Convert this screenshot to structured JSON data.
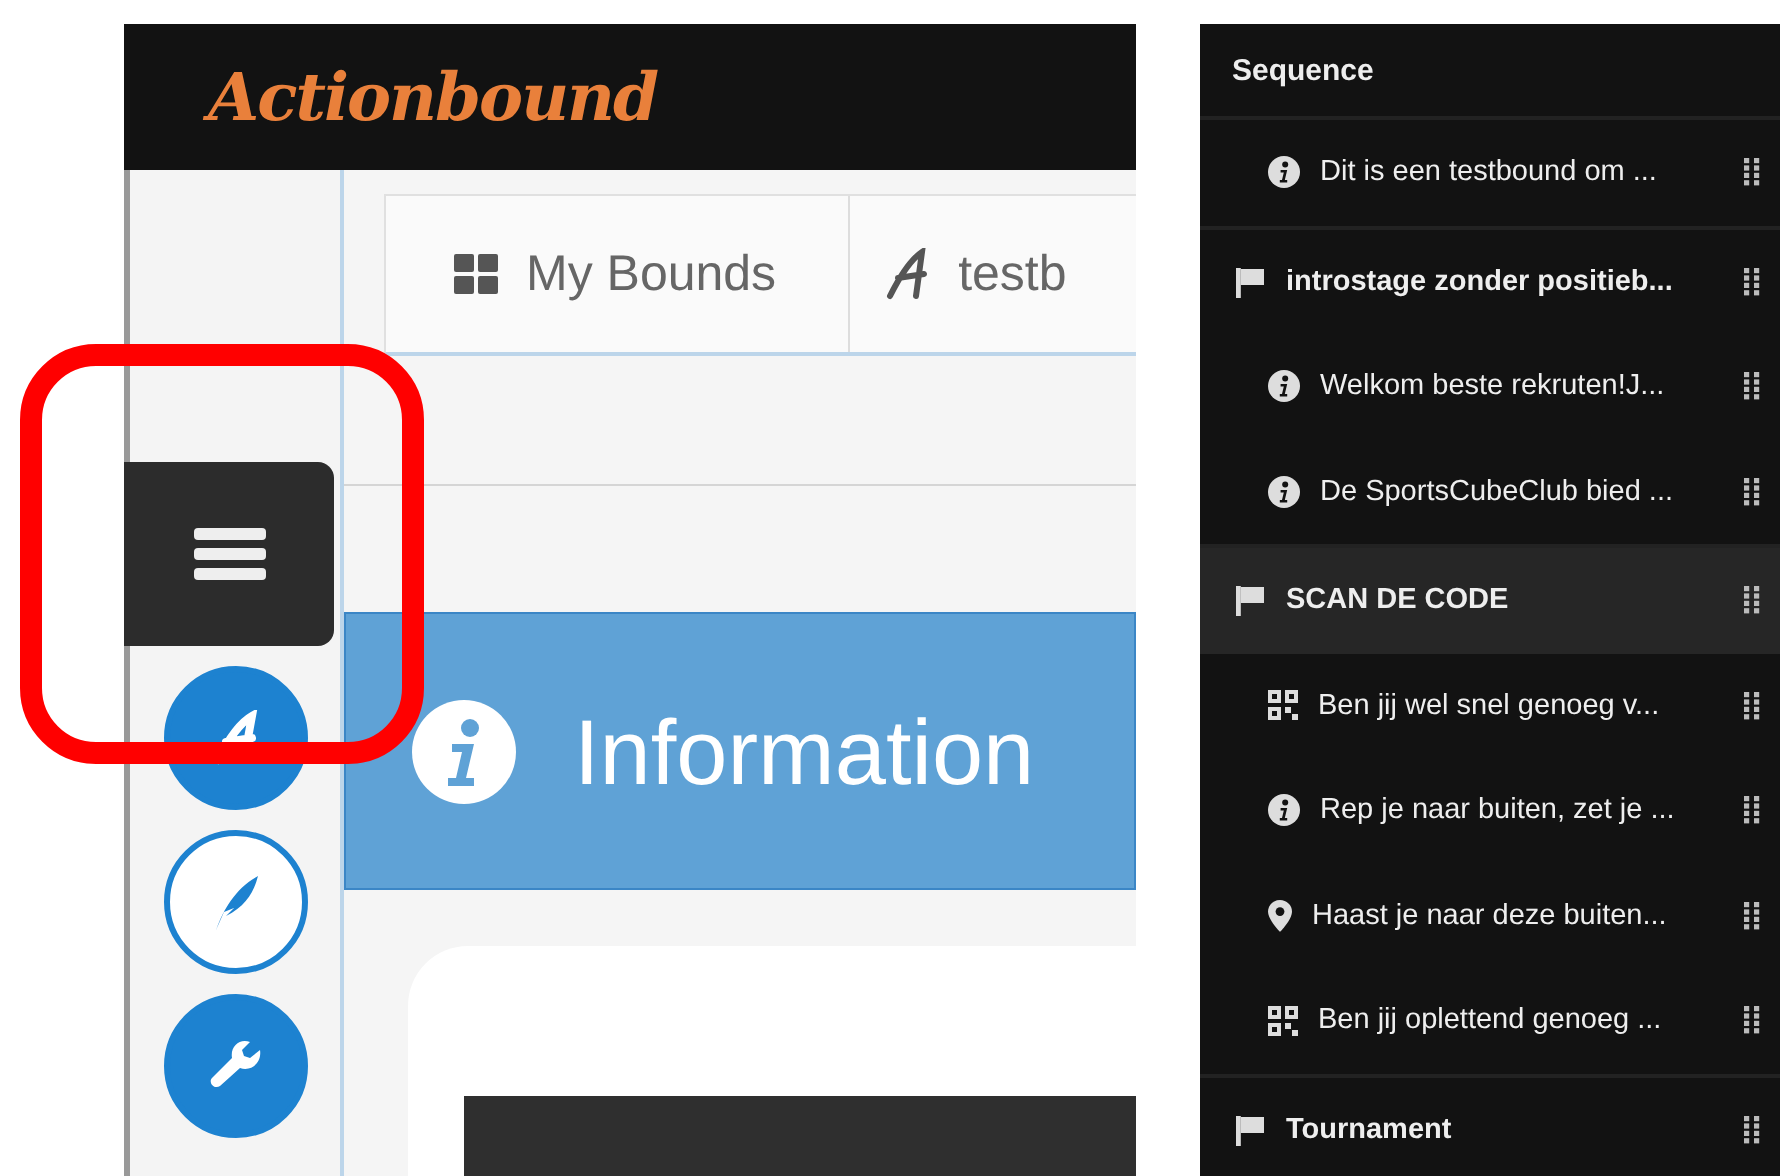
{
  "app": {
    "logo": "Actionbound"
  },
  "breadcrumbs": [
    {
      "kind": "overview",
      "label": "My Bounds"
    },
    {
      "kind": "bound",
      "label": "testb"
    }
  ],
  "tools": [
    {
      "kind": "menu",
      "selected": false
    },
    {
      "kind": "bound",
      "selected": false
    },
    {
      "kind": "quill",
      "selected": true
    },
    {
      "kind": "wrench",
      "selected": false
    }
  ],
  "content": {
    "header": "Information"
  },
  "sequence": {
    "title": "Sequence",
    "items": [
      {
        "kind": "info",
        "text": "Dit is een testbound om ...",
        "selected": false
      },
      {
        "kind": "stage",
        "text": "introstage zonder positieb...",
        "selected": false,
        "children": [
          {
            "kind": "info",
            "text": "Welkom beste rekruten!J...",
            "selected": false
          },
          {
            "kind": "info",
            "text": "De SportsCubeClub bied ...",
            "selected": false
          }
        ]
      },
      {
        "kind": "stage",
        "text": "SCAN DE CODE",
        "selected": true,
        "children": [
          {
            "kind": "code",
            "text": "Ben jij wel snel genoeg v...",
            "selected": false
          },
          {
            "kind": "info",
            "text": "Rep je naar buiten, zet je ...",
            "selected": false
          },
          {
            "kind": "location",
            "text": "Haast je naar deze buiten...",
            "selected": false
          },
          {
            "kind": "code",
            "text": "Ben jij oplettend genoeg ...",
            "selected": false
          }
        ]
      },
      {
        "kind": "stage",
        "text": "Tournament",
        "selected": false
      }
    ]
  }
}
